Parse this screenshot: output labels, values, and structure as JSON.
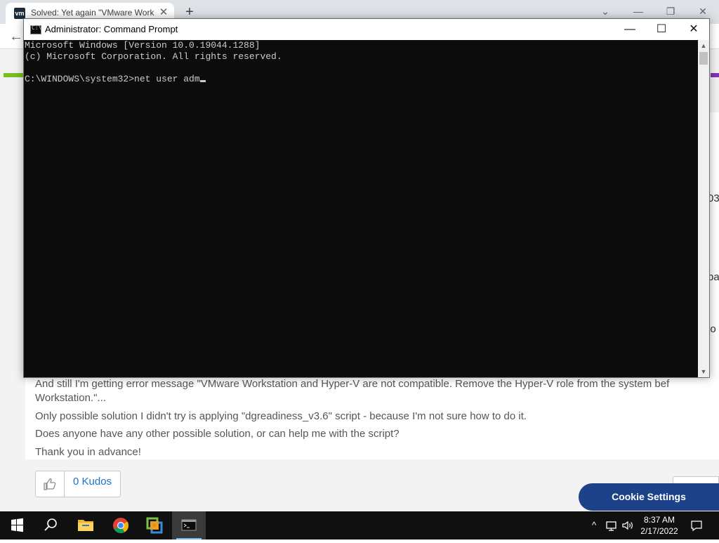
{
  "browser": {
    "tab_title": "Solved: Yet again \"VMware Work",
    "tab_favicon_text": "vm",
    "tab_close": "✕",
    "new_tab": "+",
    "controls": {
      "dropdown": "⌄",
      "minimize": "—",
      "restore": "❐",
      "close": "✕"
    },
    "back": "←"
  },
  "page": {
    "right_clip": [
      "03",
      "pa",
      "io"
    ],
    "post_lines": [
      "And still I'm getting error message \"VMware Workstation and Hyper-V are not compatible. Remove the Hyper-V role from the system bef",
      "Workstation.\"...",
      "Only possible solution I didn't try is applying \"dgreadiness_v3.6\" script - because I'm not sure how to do it.",
      "Does anyone have any other possible solution, or can help me with the script?",
      "Thank you in advance!"
    ],
    "kudos_label": "0 Kudos",
    "cookie_button": "Cookie Settings",
    "accent_green": "#78be20",
    "accent_purple": "#7f35b2"
  },
  "cmd": {
    "title": "Administrator: Command Prompt",
    "icon_text": "C:\\",
    "controls": {
      "minimize": "—",
      "maximize": "☐",
      "close": "✕"
    },
    "lines": [
      "Microsoft Windows [Version 10.0.19044.1288]",
      "(c) Microsoft Corporation. All rights reserved.",
      "",
      "C:\\WINDOWS\\system32>net user adm"
    ],
    "scroll_up": "▲",
    "scroll_down": "▼"
  },
  "taskbar": {
    "tray_chevron": "^",
    "time": "8:37 AM",
    "date": "2/17/2022",
    "accent": "#76b9ed"
  }
}
